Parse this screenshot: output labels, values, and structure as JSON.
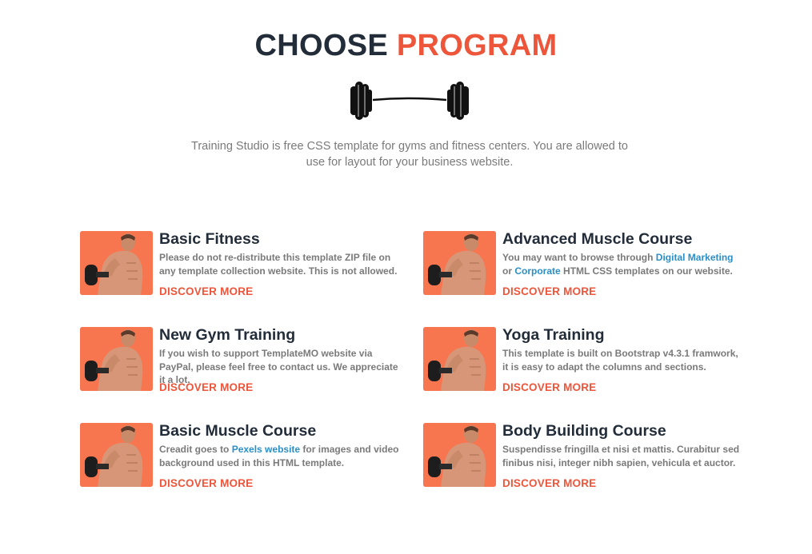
{
  "section": {
    "title_dark": "CHOOSE",
    "title_accent": "PROGRAM",
    "intro": "Training Studio is free CSS template for gyms and fitness centers. You are allowed to use for layout for your business website."
  },
  "colors": {
    "accent": "#ed563b",
    "heading": "#232d39",
    "body_text": "#7a7a7a",
    "link": "#2b8fc7",
    "thumb_bg": "#f7754f"
  },
  "programs": [
    {
      "title": "Basic Fitness",
      "desc_a": "Please do not re-distribute this template ZIP file on any template collection website. This is not allowed.",
      "link1": "",
      "desc_b": "",
      "link2": "",
      "desc_c": "",
      "more": "DISCOVER MORE"
    },
    {
      "title": "Advanced Muscle Course",
      "desc_a": "You may want to browse through ",
      "link1": "Digital Marketing",
      "desc_b": " or ",
      "link2": "Corporate",
      "desc_c": " HTML CSS templates on our website.",
      "more": "DISCOVER MORE"
    },
    {
      "title": "New Gym Training",
      "desc_a": "If you wish to support TemplateMO website via PayPal, please feel free to contact us. We appreciate it a lot.",
      "link1": "",
      "desc_b": "",
      "link2": "",
      "desc_c": "",
      "more": "DISCOVER MORE"
    },
    {
      "title": "Yoga Training",
      "desc_a": "This template is built on Bootstrap v4.3.1 framwork, it is easy to adapt the columns and sections.",
      "link1": "",
      "desc_b": "",
      "link2": "",
      "desc_c": "",
      "more": "DISCOVER MORE"
    },
    {
      "title": "Basic Muscle Course",
      "desc_a": "Creadit goes to ",
      "link1": "Pexels website",
      "desc_b": " for images and video background used in this HTML template.",
      "link2": "",
      "desc_c": "",
      "more": "DISCOVER MORE"
    },
    {
      "title": "Body Building Course",
      "desc_a": "Suspendisse fringilla et nisi et mattis. Curabitur sed finibus nisi, integer nibh sapien, vehicula et auctor.",
      "link1": "",
      "desc_b": "",
      "link2": "",
      "desc_c": "",
      "more": "DISCOVER MORE"
    }
  ]
}
